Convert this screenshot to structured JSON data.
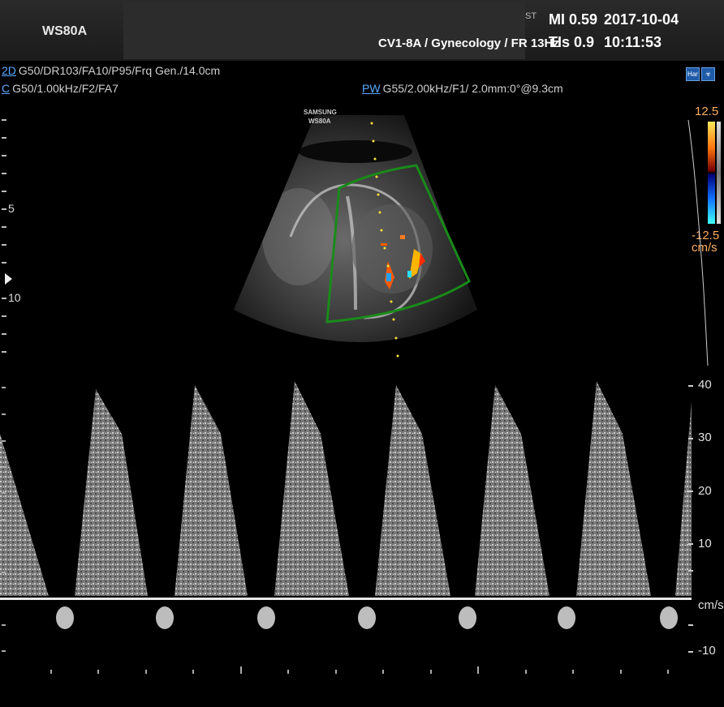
{
  "header": {
    "model": "WS80A",
    "probe_preset": "CV1-8A / Gynecology / FR 13Hz",
    "mi": "MI  0.59",
    "tis": "TIs 0.9",
    "date": "2017-10-04",
    "time": "10:11:53",
    "corner_text": "ST"
  },
  "params": {
    "mode_2d": "2D",
    "mode_2d_values": "G50/DR103/FA10/P95/Frq Gen./14.0cm",
    "mode_c": "C",
    "mode_c_values": "G50/1.00kHz/F2/FA7",
    "mode_pw": "PW",
    "mode_pw_values": "G55/2.00kHz/F1/ 2.0mm:0°@9.3cm"
  },
  "probe_logo": {
    "line1": "SAMSUNG",
    "line2": "WS80A"
  },
  "depth_labels": [
    "5",
    "10"
  ],
  "color_scale": {
    "max": "12.5",
    "min": "-12.5",
    "unit": "cm/s"
  },
  "icons": [
    "harmonic-icon",
    "biohazard-icon"
  ],
  "icon_labels": {
    "har": "Har"
  },
  "velocity_scale": {
    "labels": [
      "40",
      "30",
      "20",
      "10",
      "cm/s",
      "-10"
    ]
  }
}
